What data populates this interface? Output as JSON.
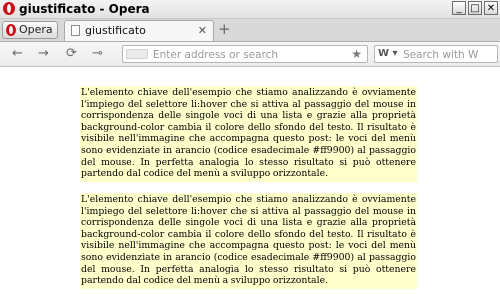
{
  "window": {
    "title": "giustificato - Opera",
    "buttons": {
      "minimize": "_",
      "maximize": "□",
      "close": "✕"
    }
  },
  "tabbar": {
    "menu_label": "Opera",
    "tabs": [
      {
        "label": "giustificato",
        "close": "✕"
      }
    ],
    "new_tab": "+"
  },
  "toolbar": {
    "back": "←",
    "forward": "→",
    "reload": "⟳",
    "key": "⊸",
    "address": {
      "placeholder": "Enter address or search",
      "value": "",
      "star": "★"
    },
    "search": {
      "engine": "W ▾",
      "placeholder": "Search with W"
    }
  },
  "content": {
    "paragraphs": [
      "L'elemento chiave dell'esempio che stiamo analizzando è ovviamente l'impiego del selettore li:hover che si attiva al passaggio del mouse in corrispondenza delle singole voci di una lista e grazie alla proprietà background-color cambia il colore dello sfondo del testo. Il risultato è visibile nell'immagine che accompagna questo post: le voci del menù sono evidenziate in arancio (codice esadecimale #ff9900) al passaggio del mouse. In perfetta analogia lo stesso risultato si può ottenere partendo dal codice del menù a sviluppo orizzontale.",
      "L'elemento chiave dell'esempio che stiamo analizzando è ovviamente l'impiego del selettore li:hover che si attiva al passaggio del mouse in corrispondenza delle singole voci di una lista e grazie alla proprietà background-color cambia il colore dello sfondo del testo. Il risultato è visibile nell'immagine che accompagna questo post: le voci del menù sono evidenziate in arancio (codice esadecimale #ff9900) al passaggio del mouse. In perfetta analogia lo stesso risultato si può ottenere partendo dal codice del menù a sviluppo orizzontale."
    ]
  }
}
